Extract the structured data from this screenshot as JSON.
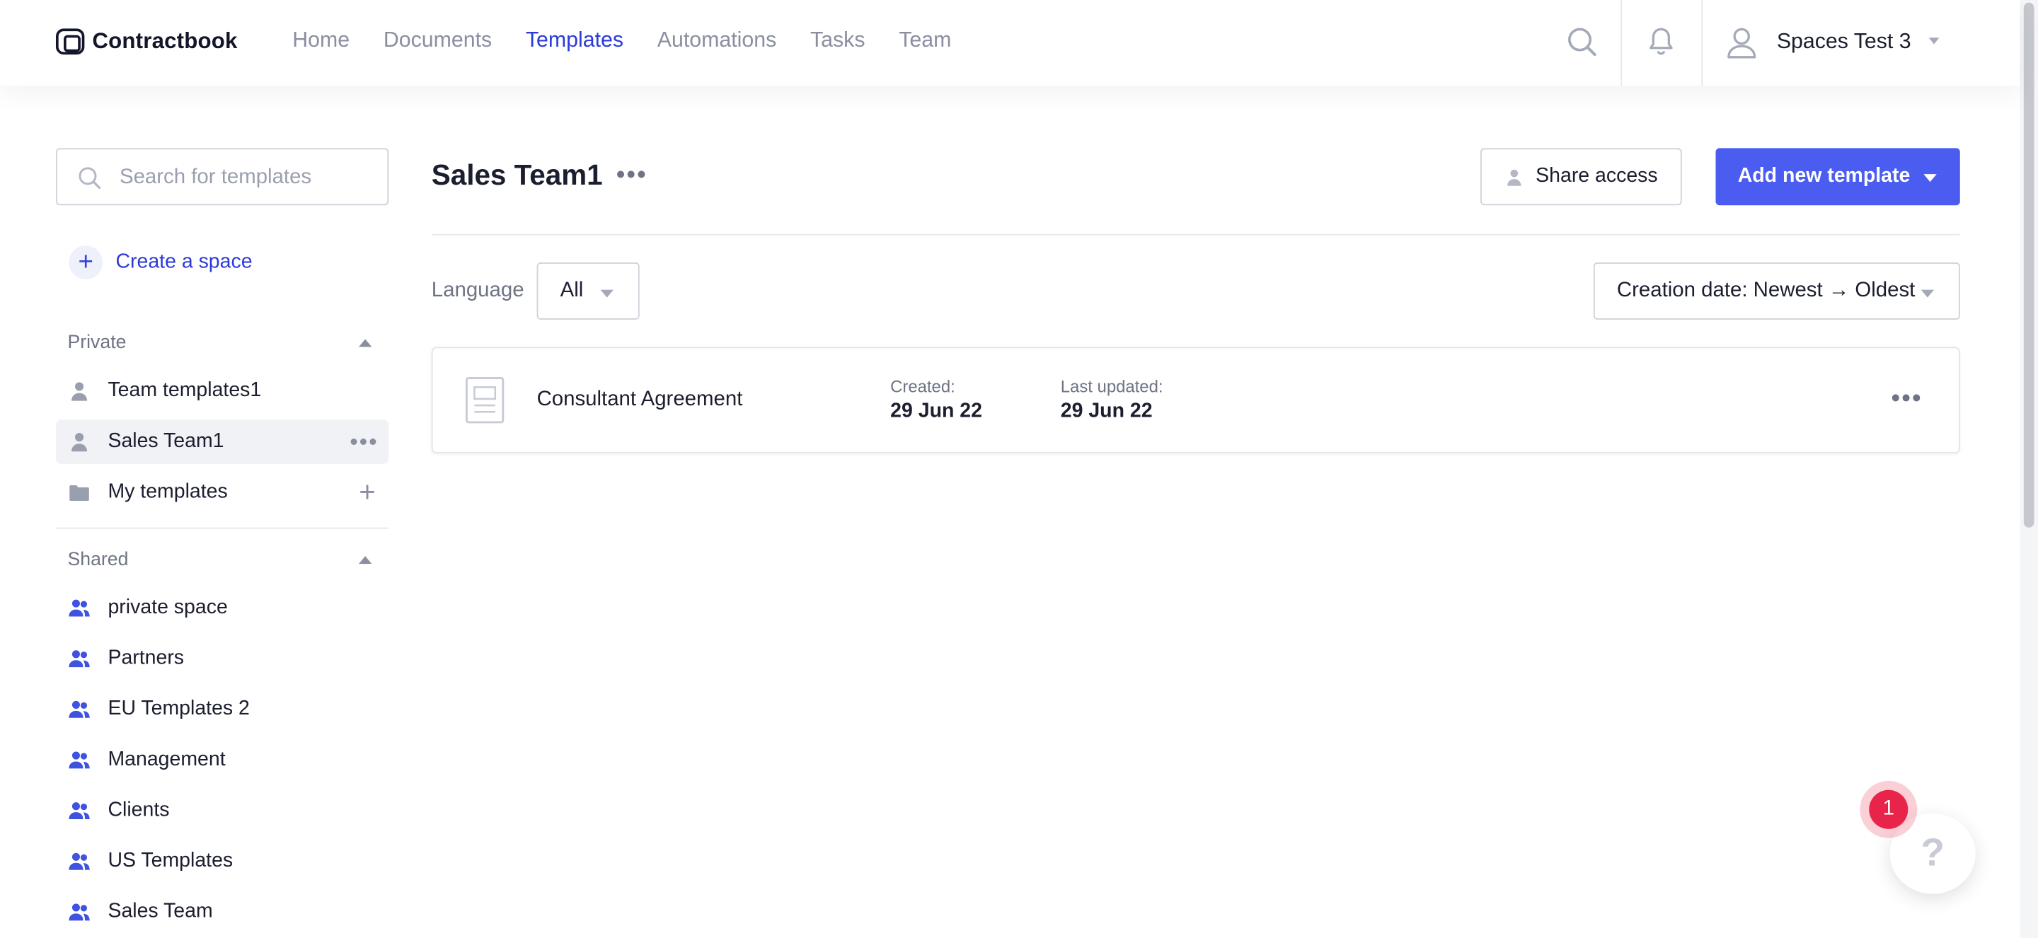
{
  "app": {
    "name": "Contractbook"
  },
  "nav": {
    "items": [
      {
        "label": "Home",
        "active": false
      },
      {
        "label": "Documents",
        "active": false
      },
      {
        "label": "Templates",
        "active": true
      },
      {
        "label": "Automations",
        "active": false
      },
      {
        "label": "Tasks",
        "active": false
      },
      {
        "label": "Team",
        "active": false
      }
    ],
    "search_icon": "search-icon",
    "notifications_icon": "bell-icon",
    "user": {
      "name": "Spaces Test 3",
      "icon": "user-icon"
    }
  },
  "sidebar": {
    "search": {
      "placeholder": "Search for templates",
      "value": ""
    },
    "create_space_label": "Create a space",
    "private": {
      "title": "Private",
      "items": [
        {
          "label": "Team templates1",
          "icon": "person-icon"
        },
        {
          "label": "Sales Team1",
          "icon": "person-icon",
          "selected": true
        },
        {
          "label": "My templates",
          "icon": "folder-icon"
        }
      ]
    },
    "shared": {
      "title": "Shared",
      "items": [
        {
          "label": "private space",
          "icon": "people-icon"
        },
        {
          "label": "Partners",
          "icon": "people-icon"
        },
        {
          "label": "EU Templates 2",
          "icon": "people-icon"
        },
        {
          "label": "Management",
          "icon": "people-icon"
        },
        {
          "label": "Clients",
          "icon": "people-icon"
        },
        {
          "label": "US Templates",
          "icon": "people-icon"
        },
        {
          "label": "Sales Team",
          "icon": "people-icon"
        }
      ]
    }
  },
  "main": {
    "title": "Sales Team1",
    "share_label": "Share access",
    "add_label": "Add new template",
    "filters": {
      "language_label": "Language",
      "language_value": "All",
      "sort_value": "Creation date: Newest → Oldest"
    },
    "templates": [
      {
        "name": "Consultant Agreement",
        "created_label": "Created:",
        "created": "29 Jun 22",
        "updated_label": "Last updated:",
        "updated": "29 Jun 22"
      }
    ]
  },
  "help": {
    "badge_count": "1",
    "label": "?"
  },
  "colors": {
    "accent": "#4a5df0",
    "nav_active": "#2b3bd6",
    "badge": "#e8244a"
  }
}
